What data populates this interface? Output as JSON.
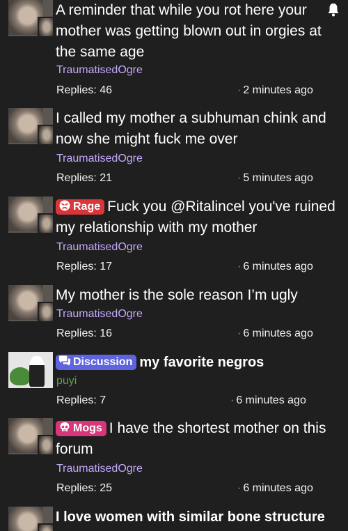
{
  "threads": [
    {
      "title": "A reminder that while you rot here your mother was getting blown out in orgies at the same age",
      "author": "TraumatisedOgre",
      "replies": "Replies: 46",
      "time": "2 minutes ago"
    },
    {
      "title": "I called my mother a subhuman chink and now she might fuck me over",
      "author": "TraumatisedOgre",
      "replies": "Replies: 21",
      "time": "5 minutes ago"
    },
    {
      "tag": "Rage",
      "title": "Fuck you @Ritalincel you've ruined my relationship with my mother",
      "author": "TraumatisedOgre",
      "replies": "Replies: 17",
      "time": "6 minutes ago"
    },
    {
      "title": "My mother is the sole reason I’m ugly",
      "author": "TraumatisedOgre",
      "replies": "Replies: 16",
      "time": "6 minutes ago"
    },
    {
      "tag": "Discussion",
      "title": "my favorite negros",
      "author": "puyi",
      "replies": "Replies: 7",
      "time": "6 minutes ago"
    },
    {
      "tag": "Mogs",
      "title": "I have the shortest mother on this forum",
      "author": "TraumatisedOgre",
      "replies": "Replies: 25",
      "time": "6 minutes ago"
    },
    {
      "title": "I love women with similar bone structure"
    }
  ],
  "icons": {
    "notification": "bell-icon",
    "rage_tag": "angry-face-icon",
    "discussion_tag": "chat-bubbles-icon",
    "mogs_tag": "skull-icon"
  },
  "colors": {
    "background": "#1f1f1f",
    "author": "#c5a8ff",
    "author_alt": "#5ea04e",
    "tag_rage": "#d9363b",
    "tag_discussion": "#5e63e0",
    "tag_mogs": "#d9357a"
  }
}
